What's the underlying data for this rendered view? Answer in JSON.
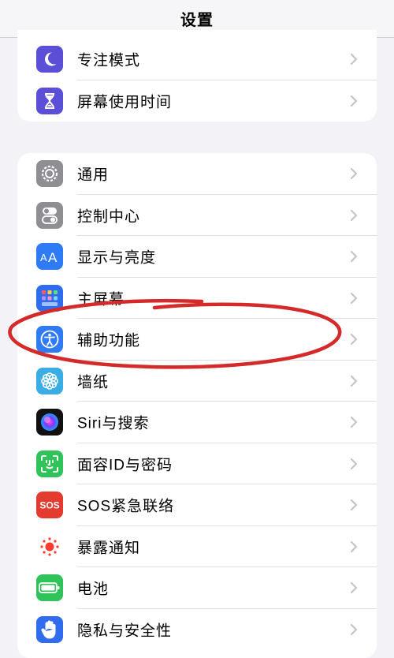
{
  "header": {
    "title": "设置"
  },
  "group1": {
    "items": [
      {
        "label": "专注模式",
        "icon": "moon-icon",
        "color": "#5a4fd6"
      },
      {
        "label": "屏幕使用时间",
        "icon": "hourglass-icon",
        "color": "#5a4fd6"
      }
    ]
  },
  "group2": {
    "items": [
      {
        "label": "通用",
        "icon": "gear-icon",
        "color": "#8e8e93"
      },
      {
        "label": "控制中心",
        "icon": "toggles-icon",
        "color": "#8e8e93"
      },
      {
        "label": "显示与亮度",
        "icon": "text-size-icon",
        "color": "#2f7bf5"
      },
      {
        "label": "主屏幕",
        "icon": "home-screen-grid-icon",
        "color": "#2f6cf0"
      },
      {
        "label": "辅助功能",
        "icon": "accessibility-icon",
        "color": "#2f7bf5"
      },
      {
        "label": "墙纸",
        "icon": "flower-icon",
        "color": "#3aaee4"
      },
      {
        "label": "Siri与搜索",
        "icon": "siri-icon",
        "color": "#111111"
      },
      {
        "label": "面容ID与密码",
        "icon": "face-id-icon",
        "color": "#2fc35a"
      },
      {
        "label": "SOS紧急联络",
        "icon": "sos-icon",
        "color": "#e33b30"
      },
      {
        "label": "暴露通知",
        "icon": "exposure-icon",
        "color": "#ffffff"
      },
      {
        "label": "电池",
        "icon": "battery-icon",
        "color": "#2fc35a"
      },
      {
        "label": "隐私与安全性",
        "icon": "hand-icon",
        "color": "#2f6cf0"
      }
    ]
  },
  "annotation": {
    "color": "#d42a2a",
    "target": "辅助功能"
  }
}
